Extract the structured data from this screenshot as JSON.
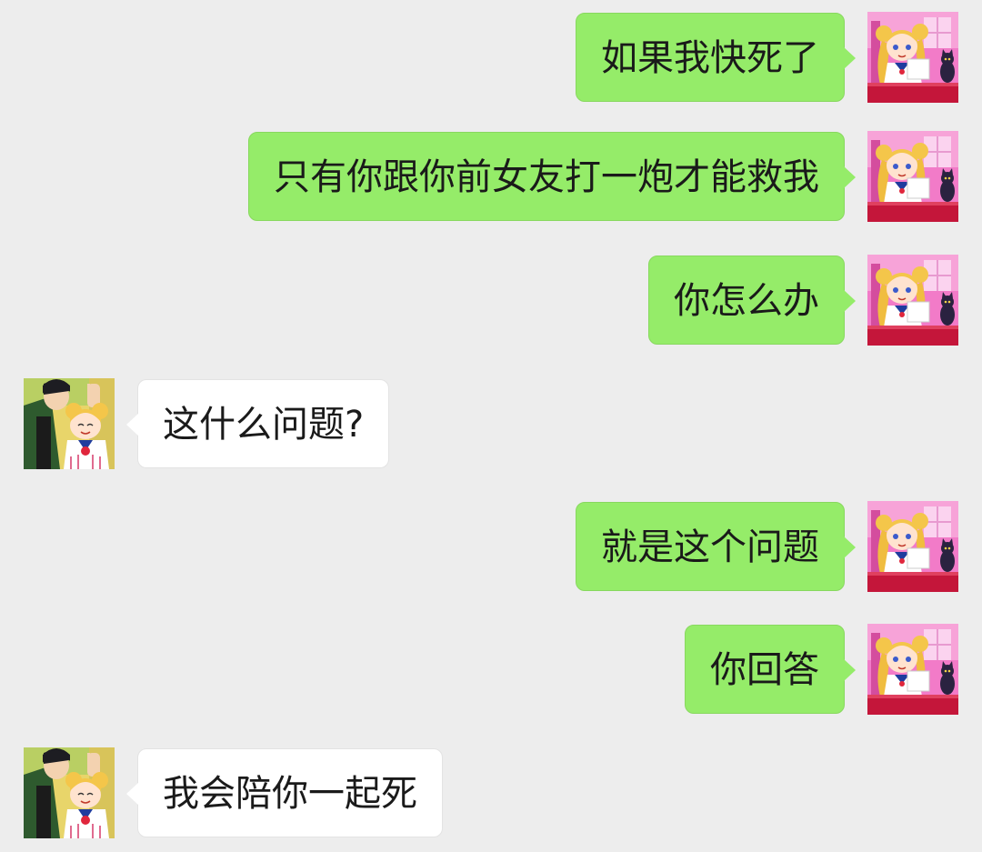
{
  "chat": {
    "messages": [
      {
        "side": "right",
        "sender": "me",
        "avatar_icon": "usagi-avatar-icon",
        "text": "如果我快死了"
      },
      {
        "side": "right",
        "sender": "me",
        "avatar_icon": "usagi-avatar-icon",
        "text": "只有你跟你前女友打一炮才能救我"
      },
      {
        "side": "right",
        "sender": "me",
        "avatar_icon": "usagi-avatar-icon",
        "text": "你怎么办"
      },
      {
        "side": "left",
        "sender": "them",
        "avatar_icon": "couple-avatar-icon",
        "text": "这什么问题?"
      },
      {
        "side": "right",
        "sender": "me",
        "avatar_icon": "usagi-avatar-icon",
        "text": "就是这个问题"
      },
      {
        "side": "right",
        "sender": "me",
        "avatar_icon": "usagi-avatar-icon",
        "text": "你回答"
      },
      {
        "side": "left",
        "sender": "them",
        "avatar_icon": "couple-avatar-icon",
        "text": "我会陪你一起死"
      }
    ]
  },
  "colors": {
    "background": "#ededed",
    "sent_bubble": "#95ec69",
    "received_bubble": "#ffffff",
    "text": "#1a1a1a"
  }
}
